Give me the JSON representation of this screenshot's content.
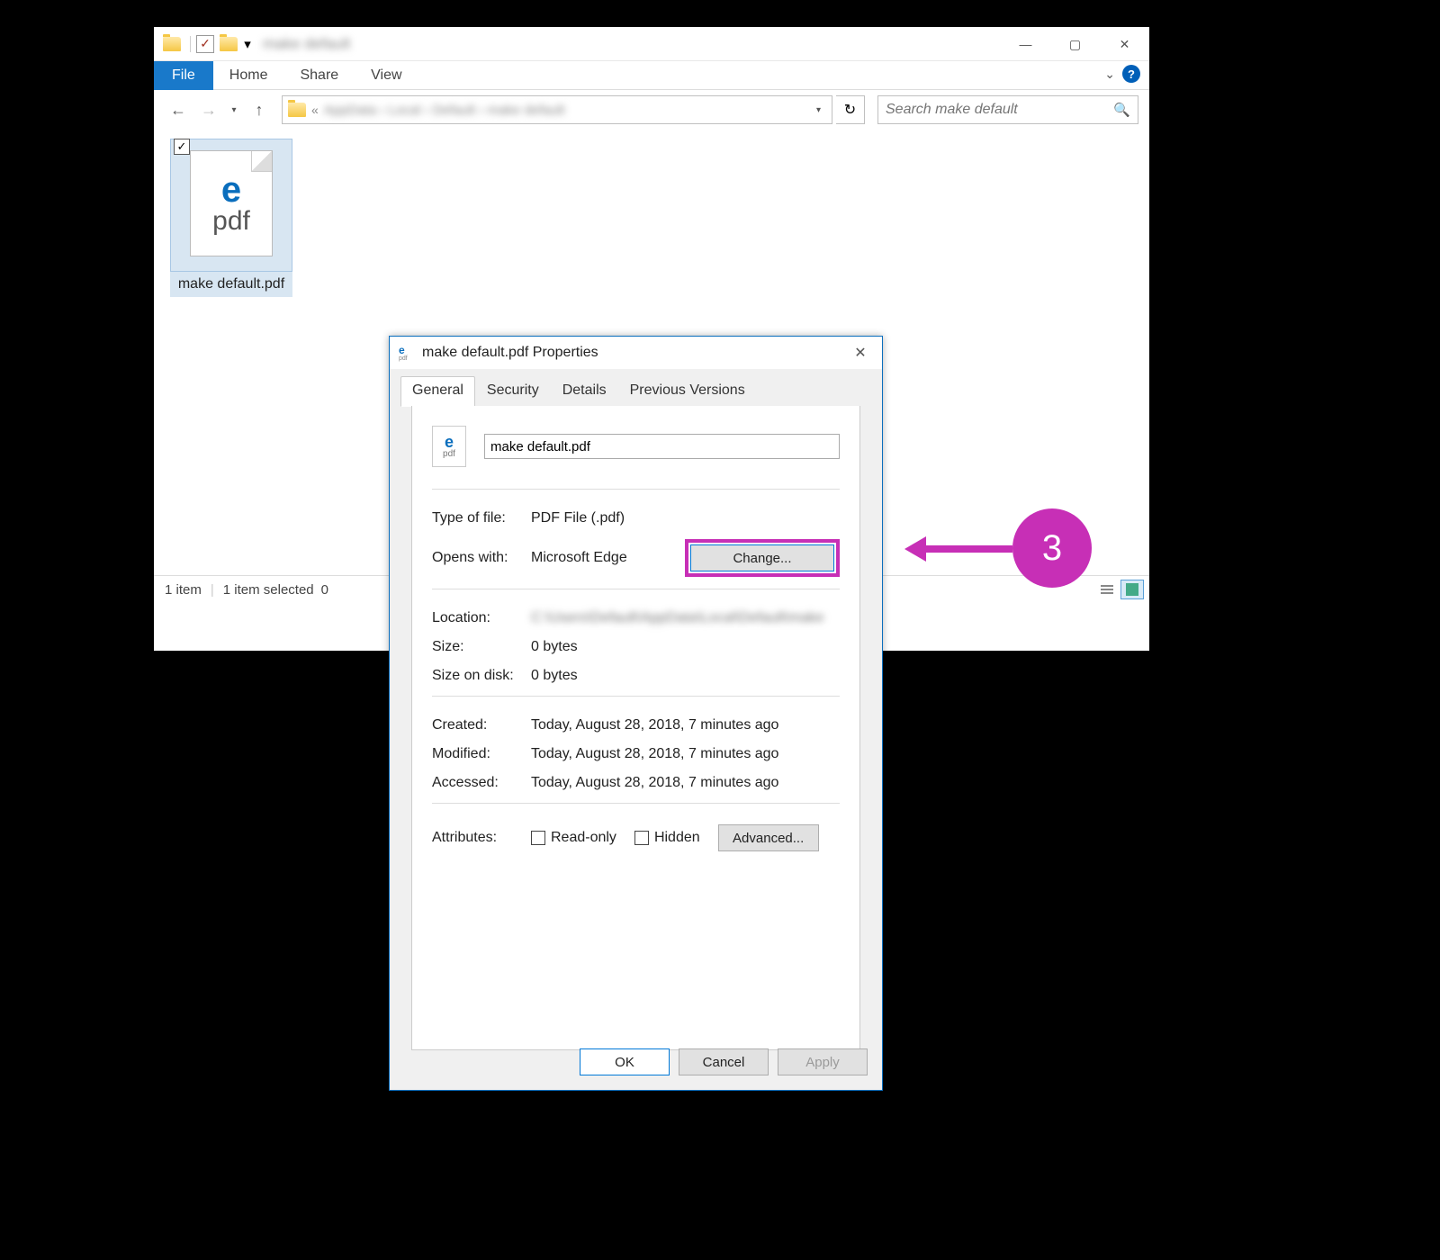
{
  "explorer": {
    "ribbon": {
      "file": "File",
      "tabs": [
        "Home",
        "Share",
        "View"
      ]
    },
    "search_placeholder": "Search make default",
    "file": {
      "name": "make default.pdf",
      "icon_text": "pdf"
    },
    "statusbar": {
      "item_count": "1 item",
      "selected": "1 item selected",
      "size": "0"
    }
  },
  "dialog": {
    "title": "make default.pdf Properties",
    "tabs": [
      "General",
      "Security",
      "Details",
      "Previous Versions"
    ],
    "filename": "make default.pdf",
    "rows": {
      "type_label": "Type of file:",
      "type_value": "PDF File (.pdf)",
      "opens_label": "Opens with:",
      "opens_value": "Microsoft Edge",
      "change_btn": "Change...",
      "location_label": "Location:",
      "size_label": "Size:",
      "size_value": "0 bytes",
      "disk_label": "Size on disk:",
      "disk_value": "0 bytes",
      "created_label": "Created:",
      "created_value": "Today, August 28, 2018, 7 minutes ago",
      "modified_label": "Modified:",
      "modified_value": "Today, August 28, 2018, 7 minutes ago",
      "accessed_label": "Accessed:",
      "accessed_value": "Today, August 28, 2018, 7 minutes ago",
      "attributes_label": "Attributes:",
      "readonly": "Read-only",
      "hidden": "Hidden",
      "advanced": "Advanced..."
    },
    "buttons": {
      "ok": "OK",
      "cancel": "Cancel",
      "apply": "Apply"
    }
  },
  "annotation": {
    "number": "3"
  }
}
